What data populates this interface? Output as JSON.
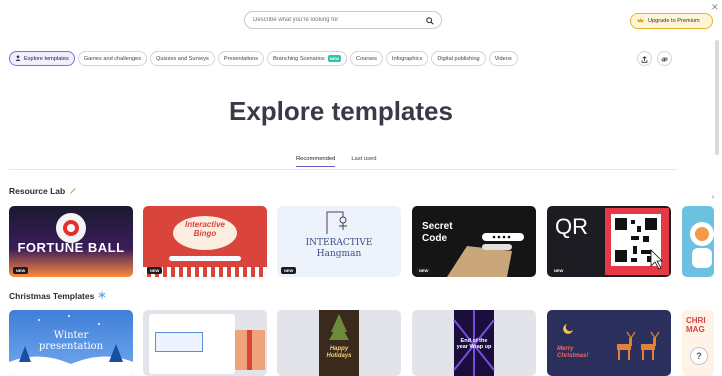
{
  "search": {
    "placeholder": "Describe what you're looking for",
    "icon": "search-icon"
  },
  "premium": {
    "label": "Upgrade to Premium",
    "icon": "crown-icon"
  },
  "chips": [
    {
      "label": "Explore templates",
      "active": true
    },
    {
      "label": "Games and challenges"
    },
    {
      "label": "Quizzes and Surveys"
    },
    {
      "label": "Presentations"
    },
    {
      "label": "Branching Scenarios",
      "badge": "NEW"
    },
    {
      "label": "Courses"
    },
    {
      "label": "Infographics"
    },
    {
      "label": "Digital publishing"
    },
    {
      "label": "Videos"
    }
  ],
  "heading": "Explore templates",
  "tabs": [
    {
      "label": "Recommended",
      "active": true
    },
    {
      "label": "Last used"
    }
  ],
  "sections": {
    "resource_lab": {
      "title": "Resource Lab",
      "cards": [
        {
          "title": "FORTUNE BALL",
          "badge": "NEW"
        },
        {
          "title": "Interactive Bingo",
          "badge": "NEW"
        },
        {
          "title": "INTERACTIVE Hangman",
          "badge": "NEW"
        },
        {
          "title": "Secret Code",
          "badge": "NEW"
        },
        {
          "title": "QR",
          "badge": "NEW"
        }
      ]
    },
    "christmas": {
      "title": "Christmas Templates",
      "cards": [
        {
          "title": "Winter presentation"
        },
        {
          "title": ""
        },
        {
          "title": "Happy Holidays"
        },
        {
          "title": "End of the year Wrap up"
        },
        {
          "title": "Merry Christmas!"
        },
        {
          "title": "CHRI MAG"
        }
      ]
    }
  },
  "colors": {
    "accent": "#6d5bd0",
    "premium_border": "#e8b12a",
    "new_badge": "#2ec4a6"
  }
}
